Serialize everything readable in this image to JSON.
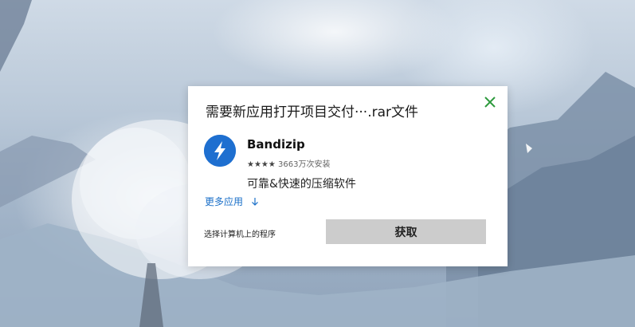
{
  "dialog": {
    "title": "需要新应用打开项目交付···.rar文件",
    "close_icon": "close-icon",
    "app": {
      "name": "Bandizip",
      "stars": "★★★★",
      "rating_text": "3663万次安装",
      "description": "可靠&快速的压缩软件",
      "logo_icon": "bandizip-lightning-icon"
    },
    "more_apps_label": "更多应用",
    "more_apps_icon": "arrow-down-icon",
    "choose_local_label": "选择计算机上的程序",
    "get_button_label": "获取"
  },
  "colors": {
    "accent_blue": "#1a6fc8",
    "logo_blue": "#1e6fd0",
    "close_green": "#2e9a3e",
    "button_gray": "#cccccc"
  }
}
